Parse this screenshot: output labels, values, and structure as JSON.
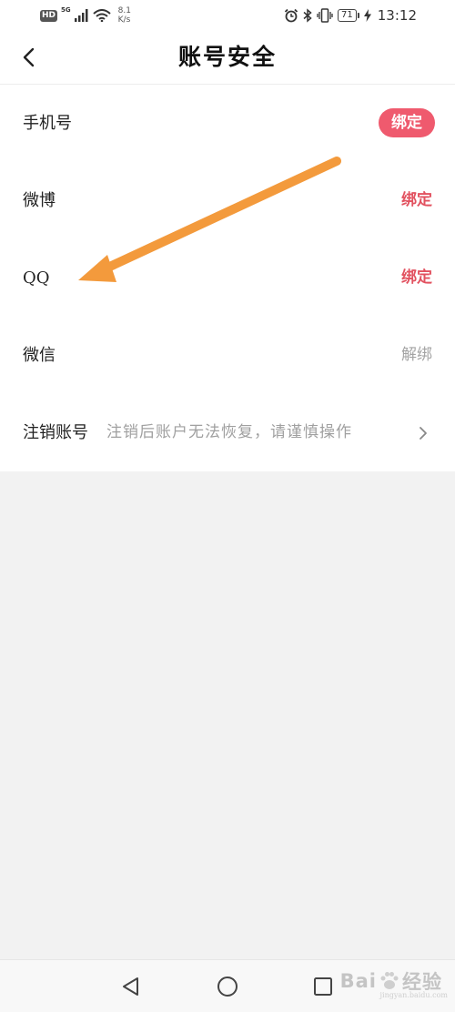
{
  "status_bar": {
    "hd": "HD",
    "network": "5G",
    "speed_value": "8.1",
    "speed_unit": "K/s",
    "battery": "71",
    "time": "13:12"
  },
  "header": {
    "title": "账号安全"
  },
  "accounts": {
    "phone": {
      "label": "手机号",
      "action": "绑定"
    },
    "weibo": {
      "label": "微博",
      "action": "绑定"
    },
    "qq": {
      "label": "QQ",
      "action": "绑定"
    },
    "wechat": {
      "label": "微信",
      "action": "解绑"
    }
  },
  "deactivate": {
    "label": "注销账号",
    "hint": "注销后账户无法恢复，请谨慎操作"
  },
  "watermark": {
    "brand": "Bai",
    "brand_suffix": "经验",
    "url": "jingyan.baidu.com"
  },
  "colors": {
    "accent": "#ef5a6e",
    "accent_text": "#e25260",
    "muted": "#a3a3a3",
    "annotation_arrow": "#f39a3c"
  }
}
